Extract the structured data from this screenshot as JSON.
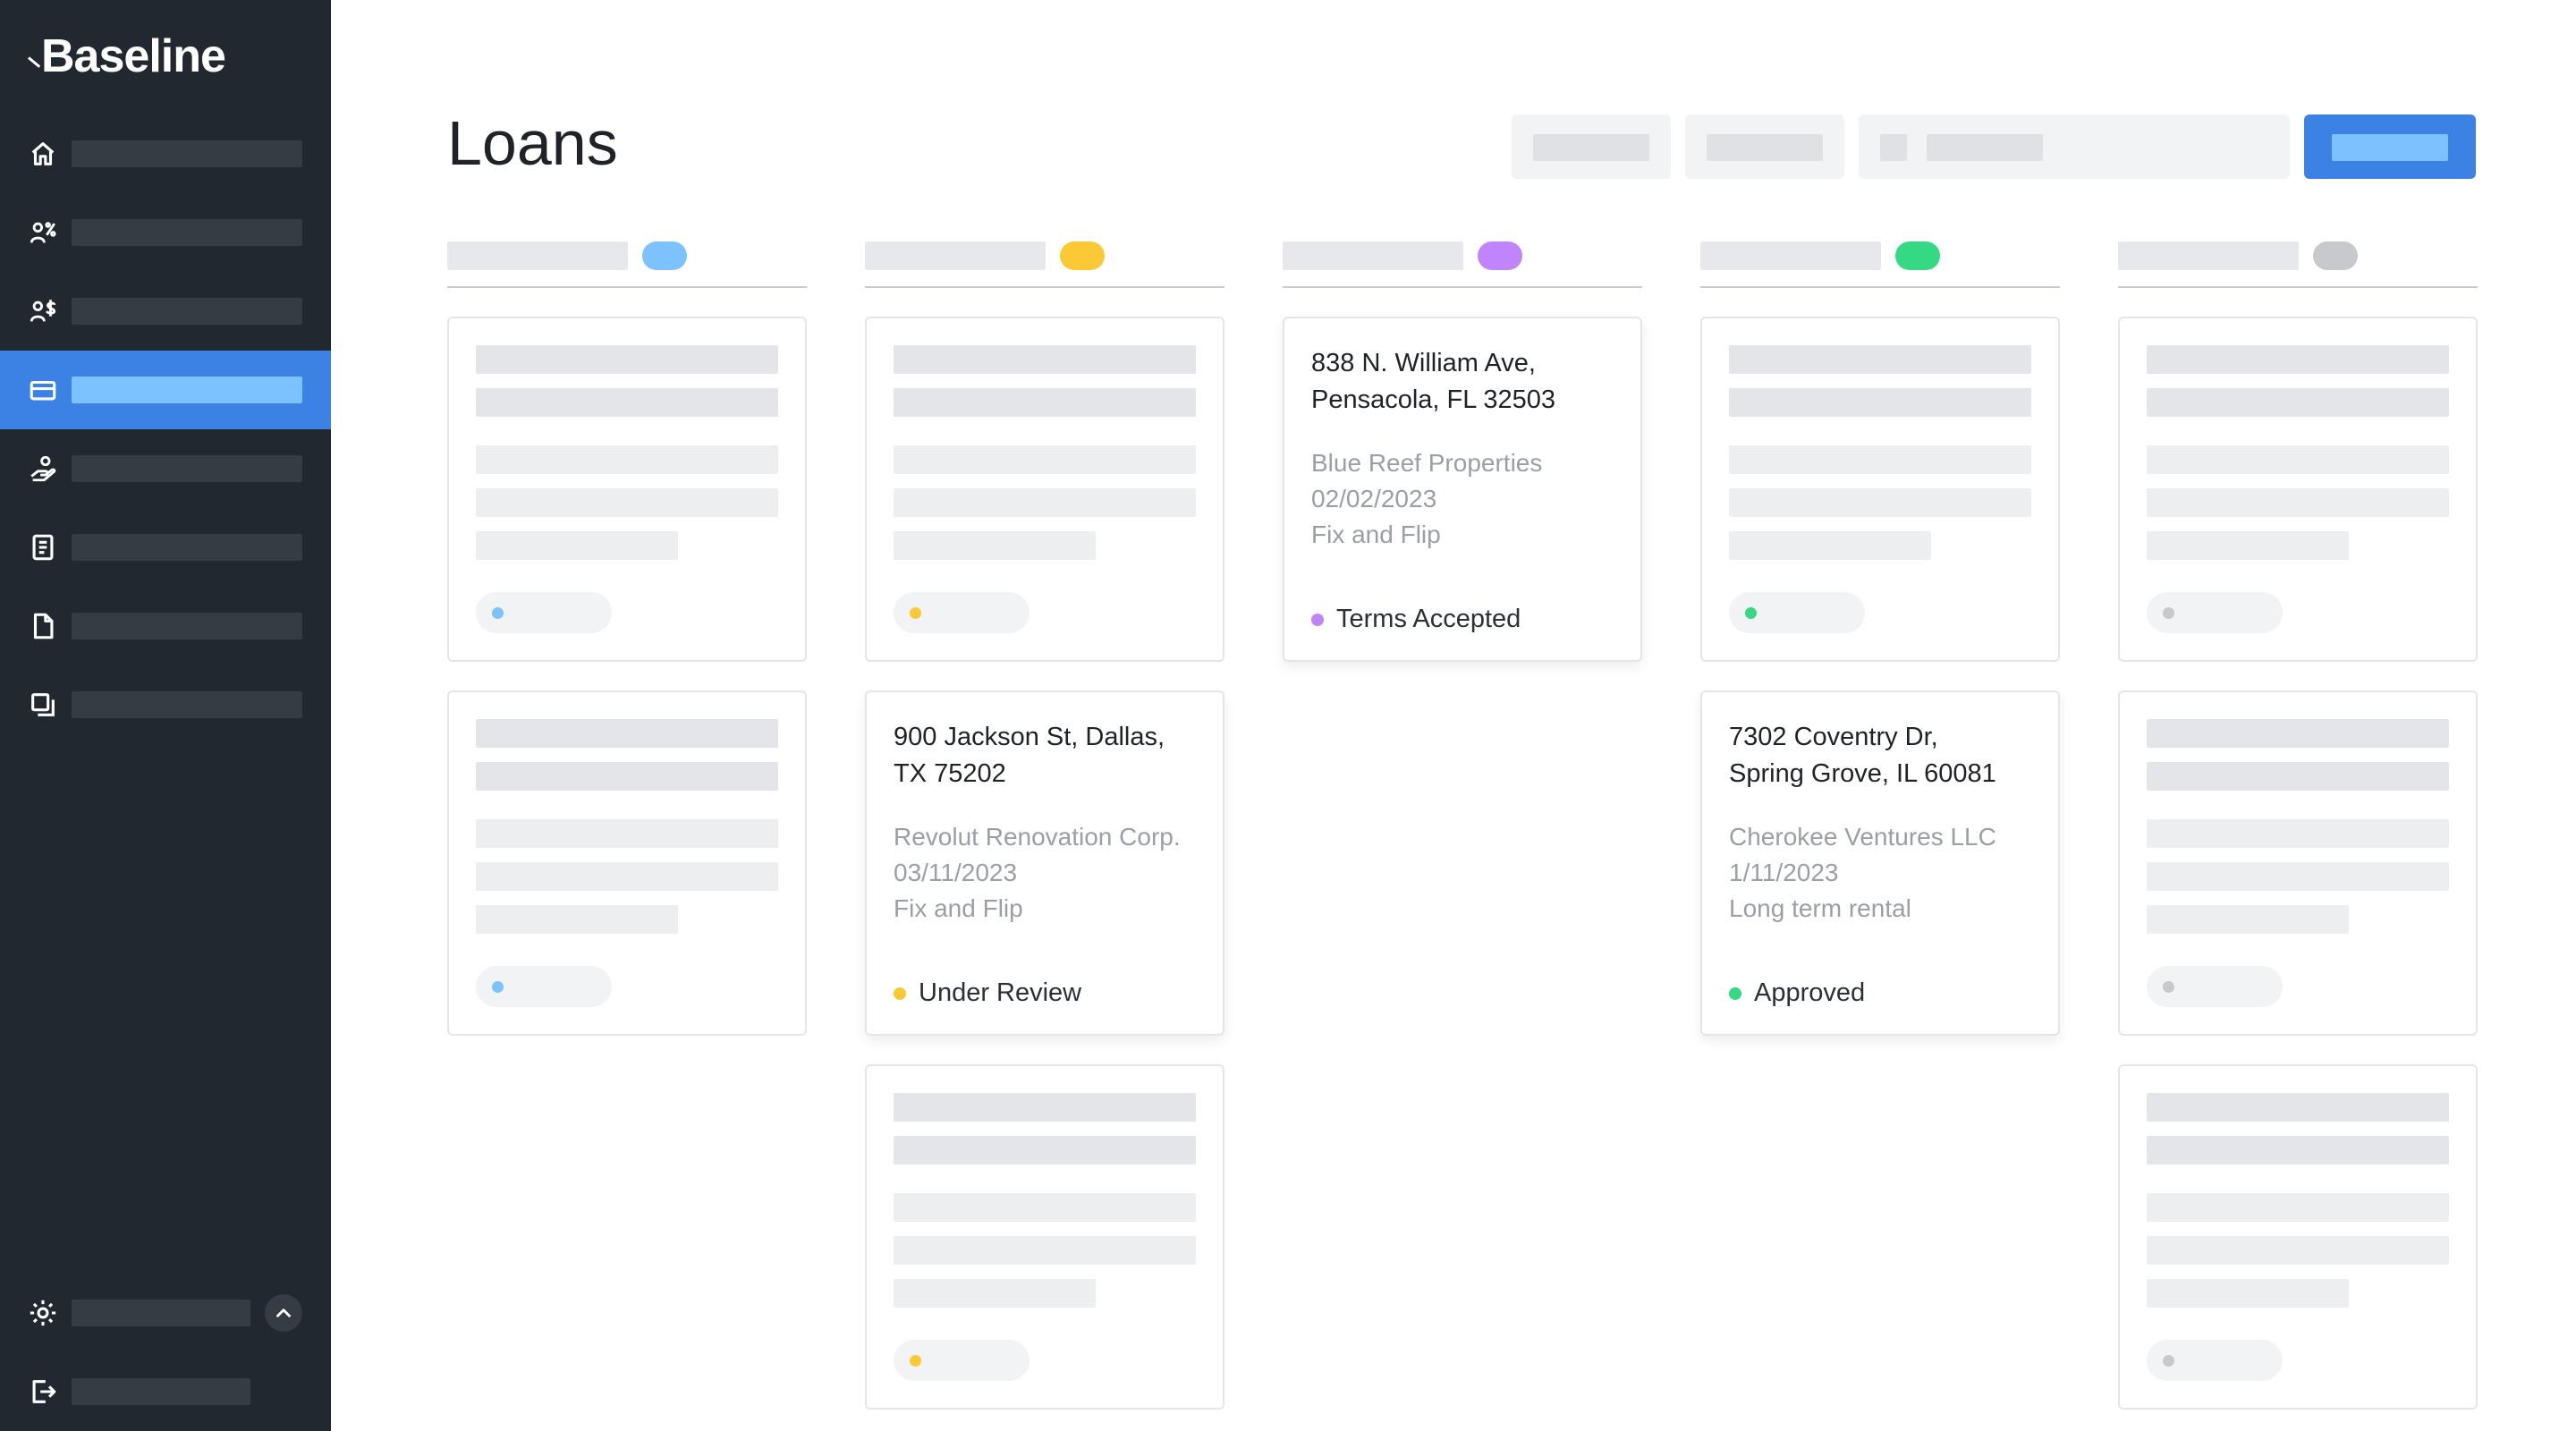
{
  "app": {
    "brand": "Baseline"
  },
  "sidebar": {
    "items": [
      {
        "icon": "home-icon",
        "active": false
      },
      {
        "icon": "people-percent-icon",
        "active": false
      },
      {
        "icon": "people-dollar-icon",
        "active": false
      },
      {
        "icon": "card-icon",
        "active": true
      },
      {
        "icon": "hand-person-icon",
        "active": false
      },
      {
        "icon": "clipboard-icon",
        "active": false
      },
      {
        "icon": "document-icon",
        "active": false
      },
      {
        "icon": "copy-icon",
        "active": false
      }
    ],
    "bottom": [
      {
        "icon": "gear-icon"
      },
      {
        "icon": "logout-icon"
      }
    ],
    "collapse_icon": "chevron-up-icon"
  },
  "page": {
    "title": "Loans"
  },
  "colors": {
    "accent": "#3b82e4",
    "sidebar_bg": "#22282f",
    "status_blue": "#7cc2ff",
    "status_yellow": "#fbc935",
    "status_purple": "#c084fc",
    "status_green": "#35d983",
    "status_gray": "#c7c9cc"
  },
  "columns": [
    {
      "color": "#7cc2ff",
      "cards": [
        {
          "skeleton": true
        },
        {
          "skeleton": true
        }
      ]
    },
    {
      "color": "#fbc935",
      "cards": [
        {
          "skeleton": true
        },
        {
          "skeleton": false,
          "address_line1": "900 Jackson St, Dallas,",
          "address_line2": "TX 75202",
          "company": "Revolut Renovation Corp.",
          "date": "03/11/2023",
          "loan_type": "Fix and Flip",
          "status": "Under Review"
        },
        {
          "skeleton": true
        }
      ]
    },
    {
      "color": "#c084fc",
      "cards": [
        {
          "skeleton": false,
          "address_line1": "838 N. William Ave,",
          "address_line2": "Pensacola, FL 32503",
          "company": "Blue Reef Properties",
          "date": "02/02/2023",
          "loan_type": "Fix and Flip",
          "status": "Terms Accepted"
        }
      ]
    },
    {
      "color": "#35d983",
      "cards": [
        {
          "skeleton": true
        },
        {
          "skeleton": false,
          "address_line1": "7302 Coventry Dr,",
          "address_line2": "Spring Grove, IL 60081",
          "company": "Cherokee Ventures LLC",
          "date": "1/11/2023",
          "loan_type": "Long term rental",
          "status": "Approved"
        }
      ]
    },
    {
      "color": "#c7c9cc",
      "cards": [
        {
          "skeleton": true
        },
        {
          "skeleton": true
        },
        {
          "skeleton": true
        }
      ]
    }
  ]
}
